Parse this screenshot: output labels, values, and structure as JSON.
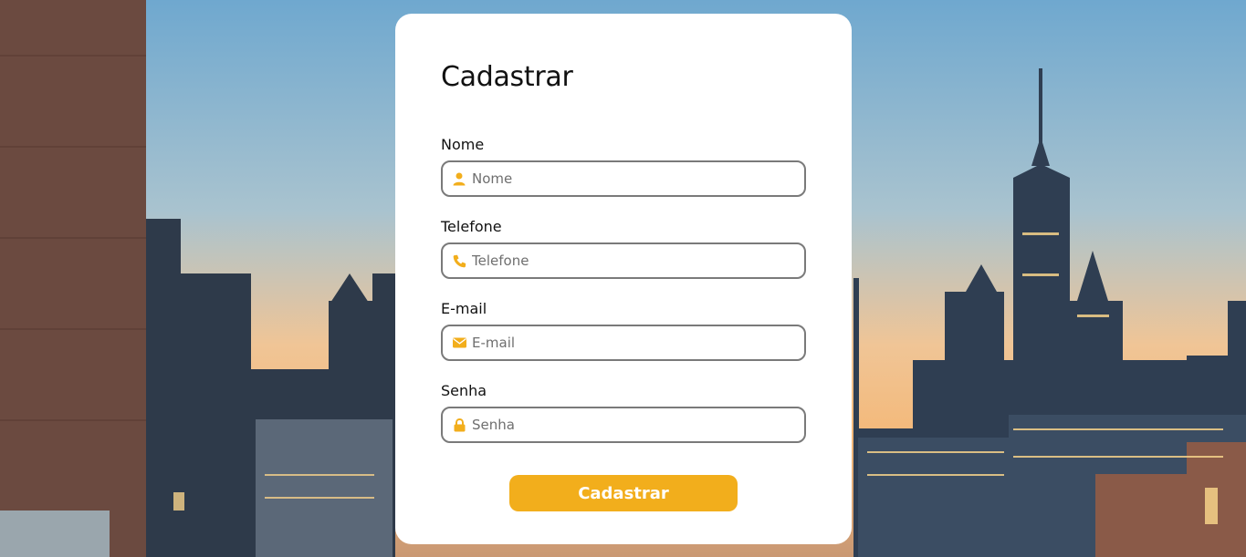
{
  "colors": {
    "accent": "#f2ae1c",
    "card": "#ffffff",
    "border": "#7a7a7a"
  },
  "form": {
    "title": "Cadastrar",
    "fields": [
      {
        "label": "Nome",
        "placeholder": "Nome",
        "value": "",
        "icon": "user-icon"
      },
      {
        "label": "Telefone",
        "placeholder": "Telefone",
        "value": "",
        "icon": "phone-icon"
      },
      {
        "label": "E-mail",
        "placeholder": "E-mail",
        "value": "",
        "icon": "envelope-icon"
      },
      {
        "label": "Senha",
        "placeholder": "Senha",
        "value": "",
        "icon": "lock-icon"
      }
    ],
    "submit_label": "Cadastrar"
  }
}
